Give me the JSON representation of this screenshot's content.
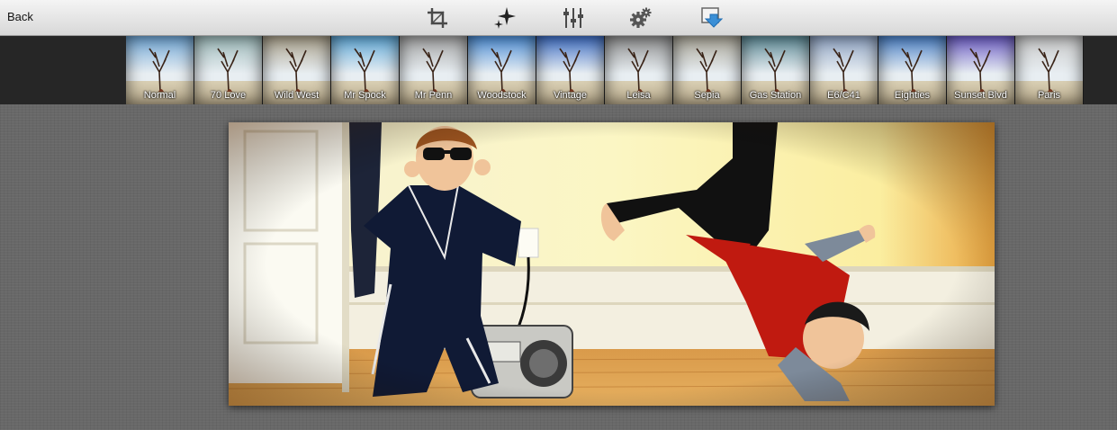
{
  "toolbar": {
    "back_label": "Back",
    "tools": [
      {
        "name": "crop-icon"
      },
      {
        "name": "sparkle-icon"
      },
      {
        "name": "sliders-icon"
      },
      {
        "name": "gears-icon"
      },
      {
        "name": "save-export-icon"
      }
    ]
  },
  "filters": [
    {
      "label": "Normal",
      "tint": "#6fa6d6"
    },
    {
      "label": "70 Love",
      "tint": "#9bb8b8"
    },
    {
      "label": "Wild West",
      "tint": "#a9a08a"
    },
    {
      "label": "Mr Spock",
      "tint": "#5fa9d9"
    },
    {
      "label": "Mr Penn",
      "tint": "#a4a4a4"
    },
    {
      "label": "Woodstock",
      "tint": "#4d8fd8"
    },
    {
      "label": "Vintage",
      "tint": "#3f6fc6"
    },
    {
      "label": "Leisa",
      "tint": "#8e8e8e"
    },
    {
      "label": "Sepia",
      "tint": "#a8a496"
    },
    {
      "label": "Gas Station",
      "tint": "#5c8a96"
    },
    {
      "label": "E6/C41",
      "tint": "#8fa4c4"
    },
    {
      "label": "Eighties",
      "tint": "#4b82c9"
    },
    {
      "label": "Sunset Blvd",
      "tint": "#6c5cc6"
    },
    {
      "label": "Paris",
      "tint": "#c9c9c9"
    }
  ],
  "colors": {
    "toolbar_bg": "#e2e2e2",
    "strip_bg": "#262626",
    "canvas_bg": "#686868",
    "accent_blue": "#3b8fd6"
  }
}
